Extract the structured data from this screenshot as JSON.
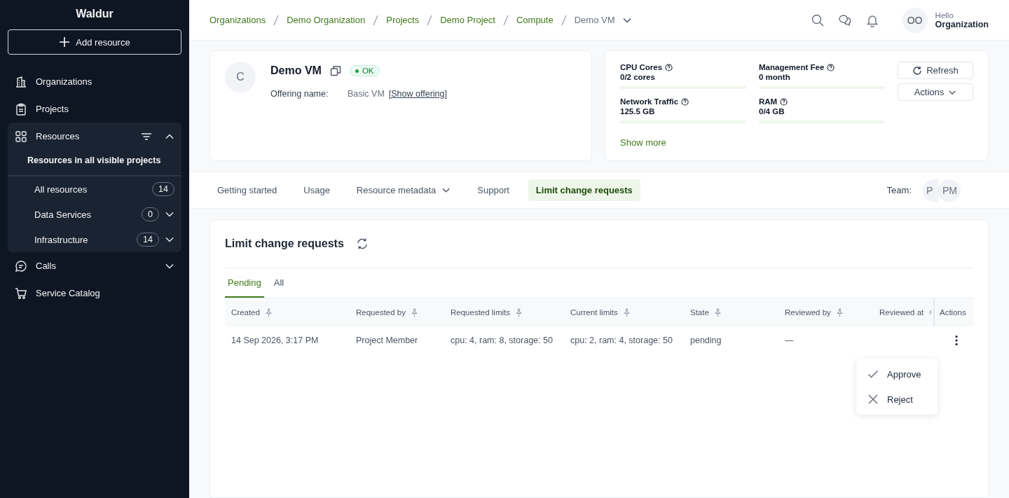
{
  "sidebar": {
    "brand": "Waldur",
    "add_button": "Add resource",
    "items": [
      {
        "kind": "link",
        "label": "Organizations"
      },
      {
        "kind": "link",
        "label": "Projects"
      },
      {
        "kind": "group",
        "label": "Resources",
        "expanded": true,
        "subtitle": "Resources in all visible projects",
        "children": [
          {
            "label": "All resources",
            "count": "14",
            "expandable": false
          },
          {
            "label": "Data Services",
            "count": "0",
            "expandable": true
          },
          {
            "label": "Infrastructure",
            "count": "14",
            "expandable": true
          }
        ]
      },
      {
        "kind": "collapsible",
        "label": "Calls",
        "expanded": false
      },
      {
        "kind": "link",
        "label": "Service Catalog"
      }
    ]
  },
  "breadcrumbs": [
    {
      "label": "Organizations",
      "current": false
    },
    {
      "label": "Demo Organization",
      "current": false
    },
    {
      "label": "Projects",
      "current": false
    },
    {
      "label": "Demo Project",
      "current": false
    },
    {
      "label": "Compute",
      "current": false
    },
    {
      "label": "Demo VM",
      "current": true
    }
  ],
  "user": {
    "initials": "OO",
    "greeting": "Hello",
    "name": "Organization"
  },
  "resource": {
    "avatar": "C",
    "name": "Demo VM",
    "status": "OK",
    "offering_label": "Offering name:",
    "offering_value": "Basic VM",
    "offering_link": "[Show offering]"
  },
  "metrics": [
    {
      "label": "CPU Cores",
      "value": "0/2 cores",
      "level": 0
    },
    {
      "label": "Management Fee",
      "value": "0 month",
      "level": 0
    },
    {
      "label": "Network Traffic",
      "value": "125.5 GB",
      "level": 0
    },
    {
      "label": "RAM",
      "value": "0/4 GB",
      "level": 0
    }
  ],
  "show_more": "Show more",
  "refresh_button": "Refresh",
  "actions_button": "Actions",
  "tabs": [
    {
      "label": "Getting started",
      "selected": false,
      "dropdown": false
    },
    {
      "label": "Usage",
      "selected": false,
      "dropdown": false
    },
    {
      "label": "Resource metadata",
      "selected": false,
      "dropdown": true
    },
    {
      "label": "Support",
      "selected": false,
      "dropdown": false
    },
    {
      "label": "Limit change requests",
      "selected": true,
      "dropdown": false
    }
  ],
  "team": {
    "label": "Team:",
    "members": [
      "P",
      "PM"
    ]
  },
  "panel": {
    "title": "Limit change requests",
    "subtabs": [
      {
        "label": "Pending",
        "selected": true
      },
      {
        "label": "All",
        "selected": false
      }
    ],
    "table": {
      "columns": [
        "Created",
        "Requested by",
        "Requested limits",
        "Current limits",
        "State",
        "Reviewed by",
        "Reviewed at",
        "Actions"
      ],
      "rows": [
        {
          "cells": [
            "14 Sep 2026, 3:17 PM",
            "Project Member",
            "cpu: 4, ram: 8, storage: 50",
            "cpu: 2, ram: 4, storage: 50",
            "pending",
            "—"
          ]
        }
      ]
    },
    "menu": [
      {
        "kind": "approve",
        "label": "Approve"
      },
      {
        "kind": "reject",
        "label": "Reject"
      }
    ]
  }
}
